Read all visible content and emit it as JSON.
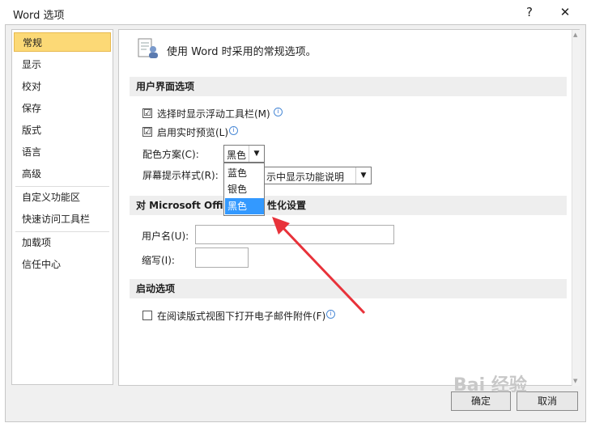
{
  "window": {
    "title": "Word 选项",
    "help_glyph": "?",
    "close_glyph": "✕"
  },
  "sidebar": {
    "items": [
      {
        "label": "常规"
      },
      {
        "label": "显示"
      },
      {
        "label": "校对"
      },
      {
        "label": "保存"
      },
      {
        "label": "版式"
      },
      {
        "label": "语言"
      },
      {
        "label": "高级"
      },
      {
        "label": "自定义功能区"
      },
      {
        "label": "快速访问工具栏"
      },
      {
        "label": "加载项"
      },
      {
        "label": "信任中心"
      }
    ]
  },
  "header": {
    "text": "使用 Word 时采用的常规选项。"
  },
  "ui_section": {
    "title": "用户界面选项",
    "mini_toolbar": {
      "label": "选择时显示浮动工具栏(M)",
      "checked": "☑"
    },
    "live_preview": {
      "label": "启用实时预览(L)",
      "checked": "☑"
    },
    "color_scheme": {
      "label": "配色方案(C):",
      "value": "黑色",
      "options": [
        "蓝色",
        "银色",
        "黑色"
      ]
    },
    "screentip": {
      "label": "屏幕提示样式(R):",
      "value_visible": "示中显示功能说明"
    }
  },
  "personal_section": {
    "title_left": "对 Microsoft Offic",
    "title_right": "性化设置",
    "username": {
      "label": "用户名(U):",
      "value": ""
    },
    "initials": {
      "label": "缩写(I):",
      "value": ""
    }
  },
  "startup_section": {
    "title": "启动选项",
    "reading_view": {
      "label": "在阅读版式视图下打开电子邮件附件(F)",
      "checked": ""
    }
  },
  "buttons": {
    "ok": "确定",
    "cancel": "取消"
  },
  "watermark": {
    "text": "Bai 经验"
  },
  "colors": {
    "selected_nav": "#fcd976",
    "dropdown_highlight": "#3399ff",
    "arrow": "#e8323a"
  }
}
